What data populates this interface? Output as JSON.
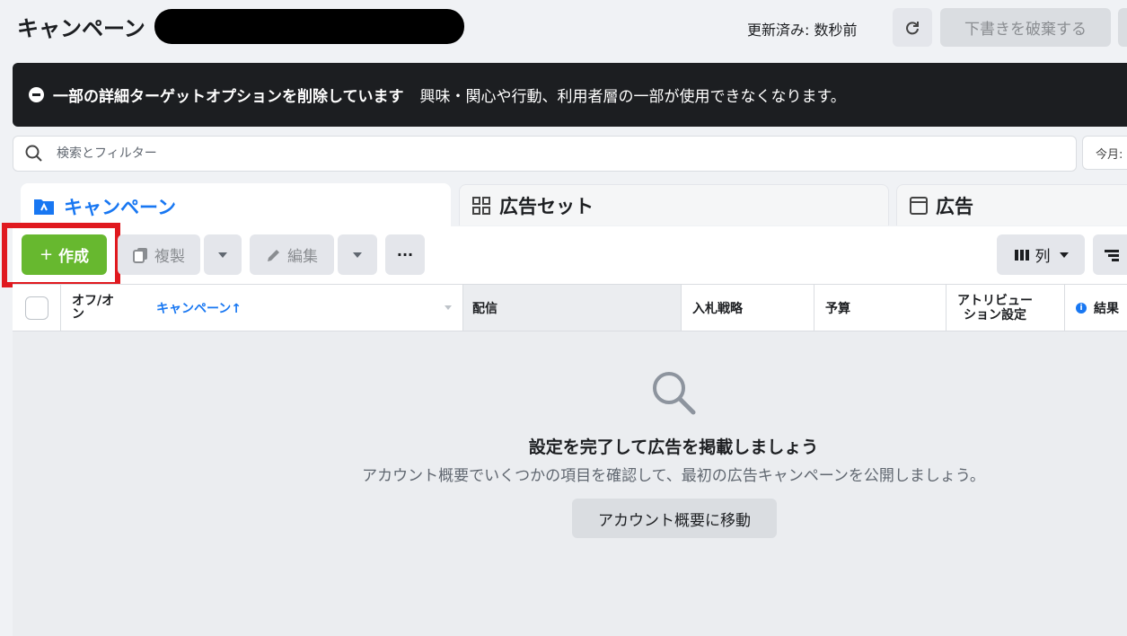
{
  "header": {
    "title": "キャンペーン",
    "updated": "更新済み: 数秒前",
    "discard_label": "下書きを破棄する"
  },
  "banner": {
    "title": "一部の詳細ターゲットオプションを削除しています",
    "text": "興味・関心や行動、利用者層の一部が使用できなくなります。"
  },
  "search": {
    "placeholder": "検索とフィルター",
    "date_label": "今月:"
  },
  "tabs": [
    {
      "label": "キャンペーン",
      "icon": "folder-icon"
    },
    {
      "label": "広告セット",
      "icon": "grid-icon"
    },
    {
      "label": "広告",
      "icon": "window-icon"
    }
  ],
  "toolbar": {
    "create_label": "作成",
    "duplicate_label": "複製",
    "edit_label": "編集",
    "more_label": "···",
    "columns_label": "列"
  },
  "table": {
    "columns": [
      "オフ/オン",
      "キャンペーン↑",
      "配信",
      "入札戦略",
      "予算",
      "アトリビューション設定",
      "結果"
    ],
    "col_onoff_1": "オフ/オ",
    "col_onoff_2": "ン",
    "col_attr_1": "アトリビュー",
    "col_attr_2": "ション設定"
  },
  "empty_state": {
    "title": "設定を完了して広告を掲載しましょう",
    "subtitle": "アカウント概要でいくつかの項目を確認して、最初の広告キャンペーンを公開しましょう。",
    "button_label": "アカウント概要に移動"
  },
  "colors": {
    "accent": "#1877f2",
    "create_green": "#67b82f",
    "highlight_red": "#e0191f",
    "banner_bg": "#1c1e21"
  }
}
